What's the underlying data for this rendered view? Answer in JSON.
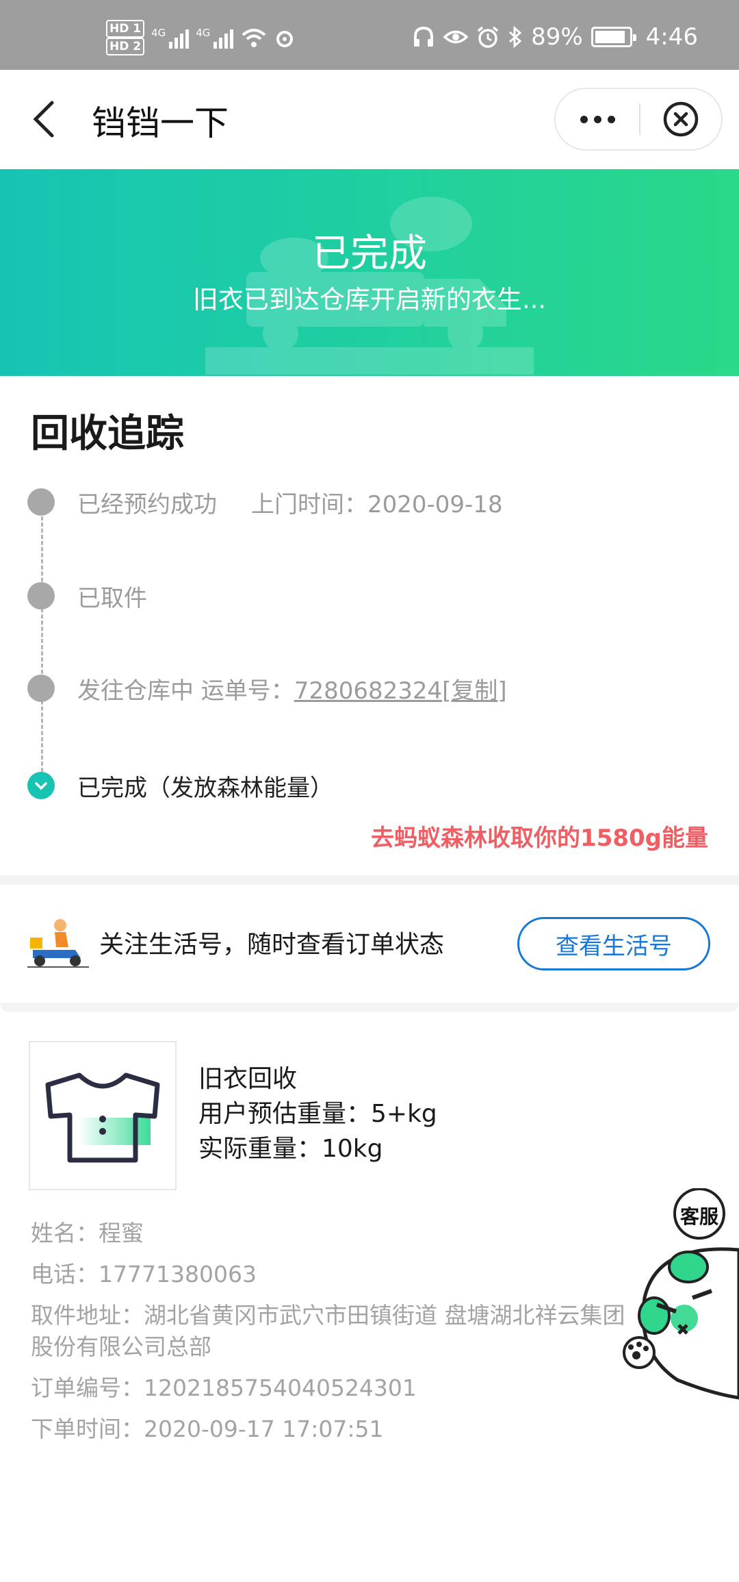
{
  "status_bar": {
    "hd1": "HD 1",
    "hd2": "HD 2",
    "net1": "4G",
    "net2": "4G",
    "battery_percent": "89%",
    "battery_level": 0.89,
    "time": "4:46"
  },
  "navbar": {
    "title": "铛铛一下"
  },
  "banner": {
    "title": "已完成",
    "subtitle": "旧衣已到达仓库开启新的衣生..."
  },
  "tracking": {
    "title": "回收追踪",
    "steps": [
      {
        "label": "已经预约成功",
        "extra": "上门时间：2020-09-18"
      },
      {
        "label": "已取件"
      },
      {
        "label": "发往仓库中 运单号：",
        "tracking_no": "7280682324",
        "copy": "[复制]"
      },
      {
        "label": "已完成（发放森林能量）"
      }
    ],
    "energy_note": "去蚂蚁森林收取你的1580g能量"
  },
  "follow": {
    "text": "关注生活号，随时查看订单状态",
    "button": "查看生活号"
  },
  "item": {
    "name": "旧衣回收",
    "estimated_weight": "用户预估重量：5+kg",
    "actual_weight": "实际重量：10kg"
  },
  "details": {
    "name": "姓名：程蜜",
    "phone": "电话：17771380063",
    "address": "取件地址：湖北省黄冈市武穴市田镇街道 盘塘湖北祥云集团股份有限公司总部",
    "order_no": "订单编号：1202185754040524301",
    "order_time": "下单时间：2020-09-17 17:07:51"
  },
  "service": {
    "label": "客服"
  },
  "colors": {
    "accent": "#17c4b4",
    "energy": "#ef5e63",
    "link": "#1677d9"
  }
}
